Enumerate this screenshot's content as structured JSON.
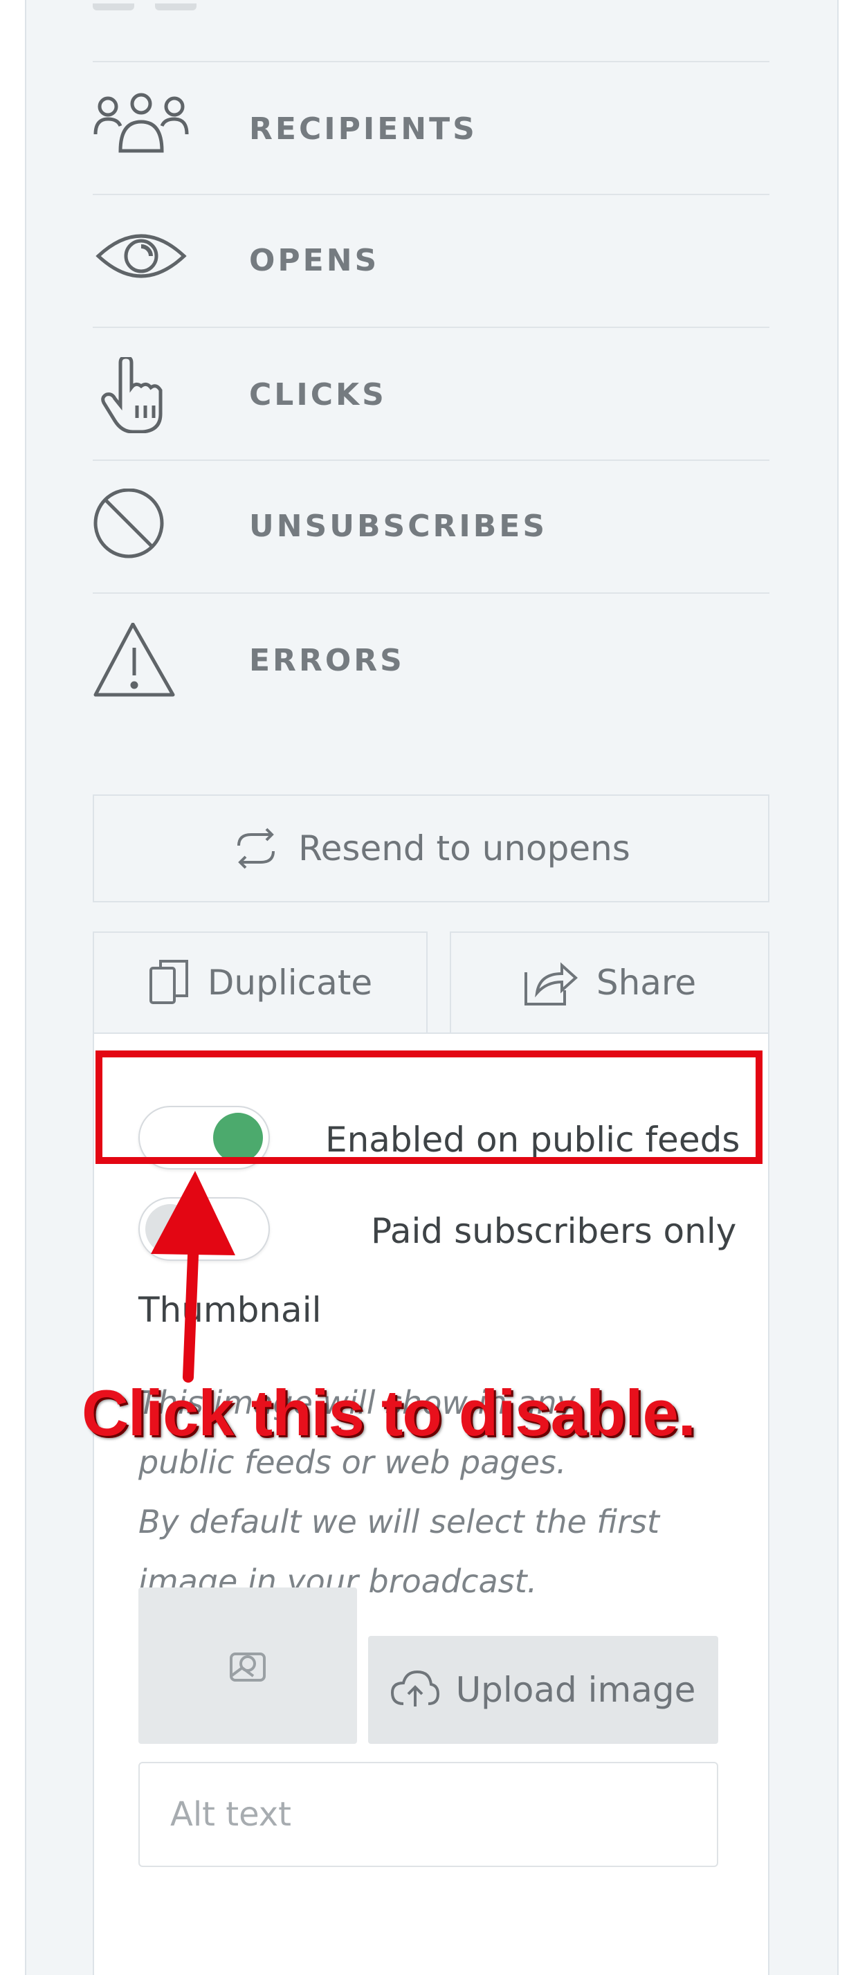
{
  "stats": {
    "items": [
      {
        "label": "RECIPIENTS",
        "icon": "recipients-icon"
      },
      {
        "label": "OPENS",
        "icon": "eye-icon"
      },
      {
        "label": "CLICKS",
        "icon": "hand-pointer-icon"
      },
      {
        "label": "UNSUBSCRIBES",
        "icon": "block-icon"
      },
      {
        "label": "ERRORS",
        "icon": "warning-icon"
      }
    ]
  },
  "actions": {
    "resend_label": "Resend to unopens",
    "duplicate_label": "Duplicate",
    "share_label": "Share"
  },
  "settings": {
    "public_feeds": {
      "label": "Enabled on public feeds",
      "enabled": true
    },
    "paid_only": {
      "label": "Paid subscribers only",
      "enabled": false
    },
    "thumbnail_label": "Thumbnail",
    "help_line1": "This image will show in any",
    "help_line2": "public feeds or web pages.",
    "help_line3": "By default we will select the first",
    "help_line4": "image in your broadcast.",
    "upload_label": "Upload image",
    "alt_placeholder": "Alt text"
  },
  "annotation": {
    "text": "Click this to disable."
  },
  "colors": {
    "toggle_on": "#4caa6d",
    "annotation_red": "#e30613"
  }
}
